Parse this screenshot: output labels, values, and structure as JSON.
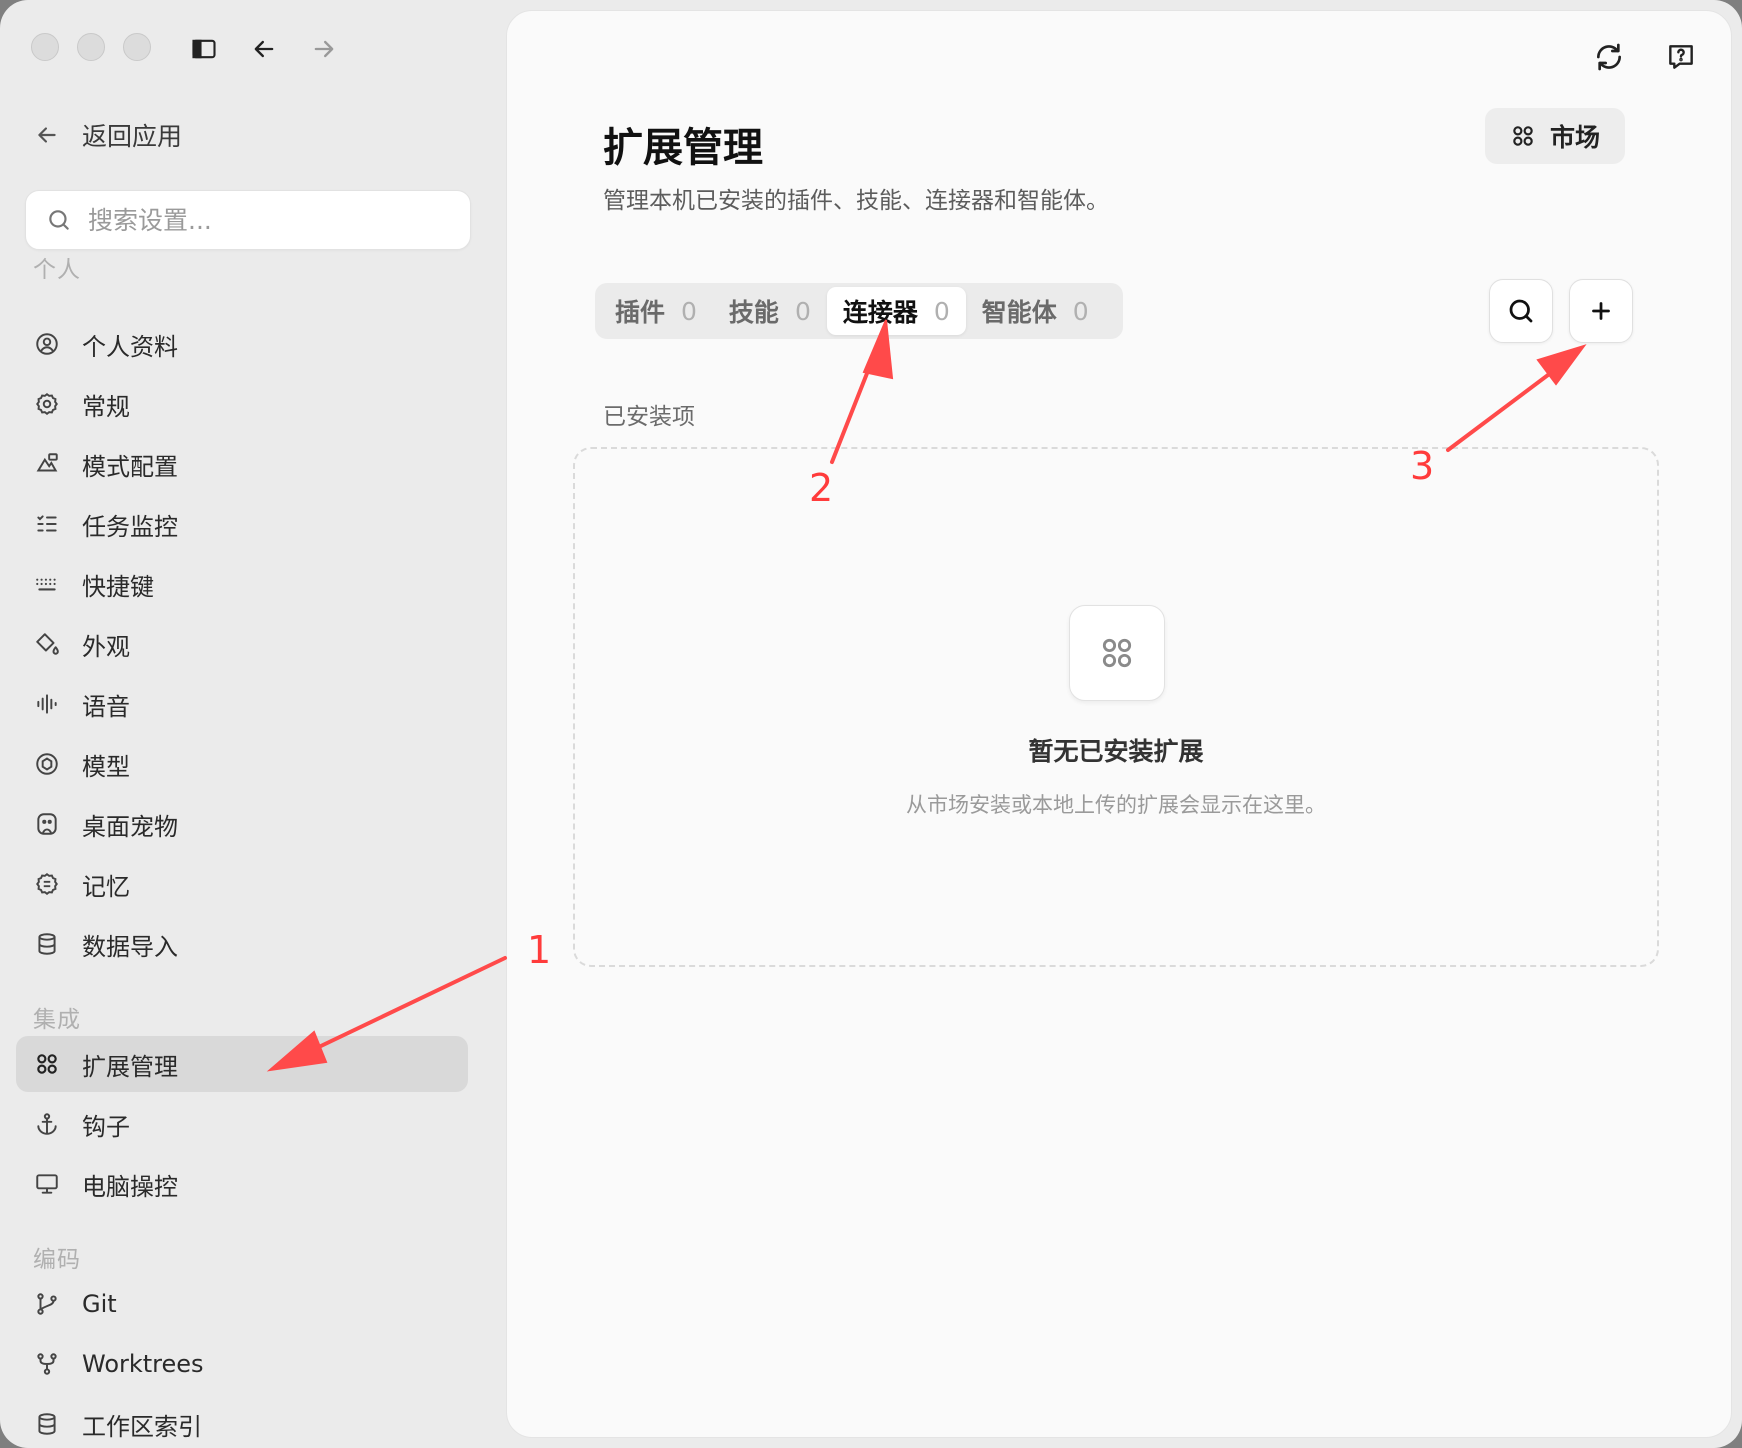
{
  "toolbar": {
    "traffic_lights": [
      "close",
      "minimize",
      "zoom"
    ],
    "icons": [
      "sidebar-toggle-icon",
      "back-arrow-icon",
      "forward-arrow-icon"
    ]
  },
  "sidebar": {
    "back_label": "返回应用",
    "search_placeholder": "搜索设置...",
    "groups": {
      "personal": "个人",
      "integration": "集成",
      "coding": "编码"
    },
    "items": {
      "profile": "个人资料",
      "general": "常规",
      "mode": "模式配置",
      "tasks": "任务监控",
      "shortcuts": "快捷键",
      "appearance": "外观",
      "voice": "语音",
      "models": "模型",
      "pet": "桌面宠物",
      "memory": "记忆",
      "import": "数据导入",
      "extensions": "扩展管理",
      "hooks": "钩子",
      "computer": "电脑操控",
      "git": "Git",
      "worktrees": "Worktrees",
      "index": "工作区索引"
    },
    "active_item": "extensions"
  },
  "main": {
    "title": "扩展管理",
    "subtitle": "管理本机已安装的插件、技能、连接器和智能体。",
    "market_label": "市场",
    "tabs": [
      {
        "label": "插件",
        "count": "0"
      },
      {
        "label": "技能",
        "count": "0"
      },
      {
        "label": "连接器",
        "count": "0"
      },
      {
        "label": "智能体",
        "count": "0"
      }
    ],
    "active_tab": "连接器",
    "section_label": "已安装项",
    "empty_title": "暂无已安装扩展",
    "empty_desc": "从市场安装或本地上传的扩展会显示在这里。"
  },
  "annotations": {
    "color": "#ff3b3b",
    "labels": [
      "1",
      "2",
      "3"
    ]
  }
}
